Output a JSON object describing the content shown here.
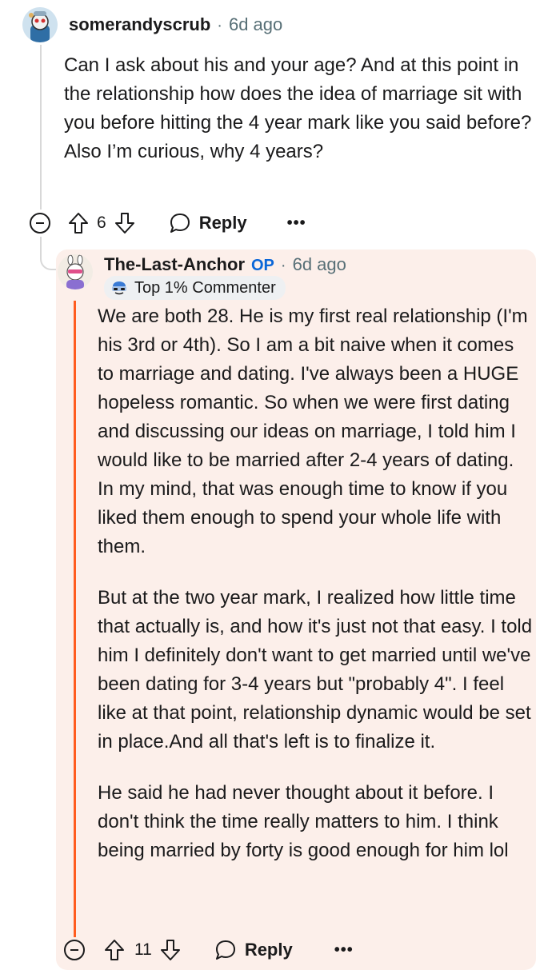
{
  "comment1": {
    "username": "somerandyscrub",
    "time": "6d ago",
    "body": "Can I ask about his and your age? And at this point in the relationship how does the idea of marriage sit with you before hitting the 4 year mark like you said before? Also I’m curious, why 4 years?",
    "votes": "6",
    "reply_label": "Reply",
    "more": "•••"
  },
  "comment2": {
    "username": "The-Last-Anchor",
    "op_label": "OP",
    "time": "6d ago",
    "badge": "Top 1% Commenter",
    "paragraphs": [
      "We are both 28. He is my first real relationship (I'm his 3rd or 4th). So I am a bit naive when it comes to marriage and dating. I've always been a HUGE hopeless romantic. So when we were first dating and discussing our ideas on marriage, I told him I would like to be married after 2-4 years of dating. In my mind, that was enough time to know if you liked them enough to spend your whole life with them.",
      "But at the two year mark, I realized how little time that actually is, and how it's just not that easy. I told him I definitely don't want to get married until we've been dating for 3-4 years but \"probably 4\". I feel like at that point, relationship dynamic would be set in place.And all that's left is to finalize it.",
      "He said he had never thought about it before. I don't think the time really matters to him. I think being married by forty is good enough for him lol"
    ],
    "votes": "11",
    "reply_label": "Reply",
    "more": "•••"
  },
  "colors": {
    "highlight_bg": "#fcefea",
    "op_accent": "#0a66d8",
    "accent_bar": "#ff5c1f"
  }
}
